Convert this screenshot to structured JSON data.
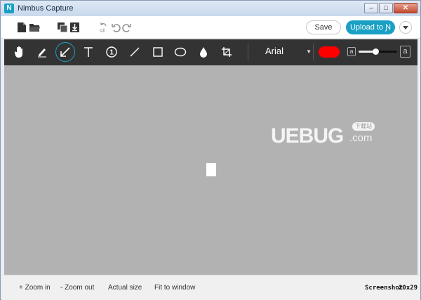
{
  "window": {
    "title": "Nimbus Capture",
    "logo_letter": "N",
    "controls": {
      "minimize": "–",
      "maximize": "□",
      "close": "✕"
    }
  },
  "topbar": {
    "save_label": "Save",
    "upload_label": "Upload to Ɲ",
    "icons": [
      "new-file-icon",
      "open-folder-icon",
      "copy-icon",
      "download-icon",
      "clear-all-icon",
      "undo-icon",
      "redo-icon"
    ]
  },
  "drawbar": {
    "tools": [
      "hand-tool-icon",
      "pen-tool-icon",
      "arrow-tool-icon",
      "text-tool-icon",
      "number-tool-icon",
      "line-tool-icon",
      "rectangle-tool-icon",
      "ellipse-tool-icon",
      "blur-tool-icon",
      "crop-tool-icon"
    ],
    "active_tool": "arrow-tool-icon",
    "font": "Arial",
    "color": "#ff0000",
    "size_small_label": "a",
    "size_large_label": "a",
    "size_level": 0.45
  },
  "watermark": {
    "text": "UEBUG",
    "suffix": ".com",
    "badge": "下载站"
  },
  "statusbar": {
    "zoom_in": "+ Zoom in",
    "zoom_out": "- Zoom out",
    "actual_size": "Actual size",
    "fit_to_window": "Fit to window",
    "screenshot_label": "Screenshot",
    "dimensions": "20x29"
  },
  "colors": {
    "accent": "#1aa0c4",
    "toolbar_bg": "#333333",
    "canvas_bg": "#b2b2b2"
  }
}
